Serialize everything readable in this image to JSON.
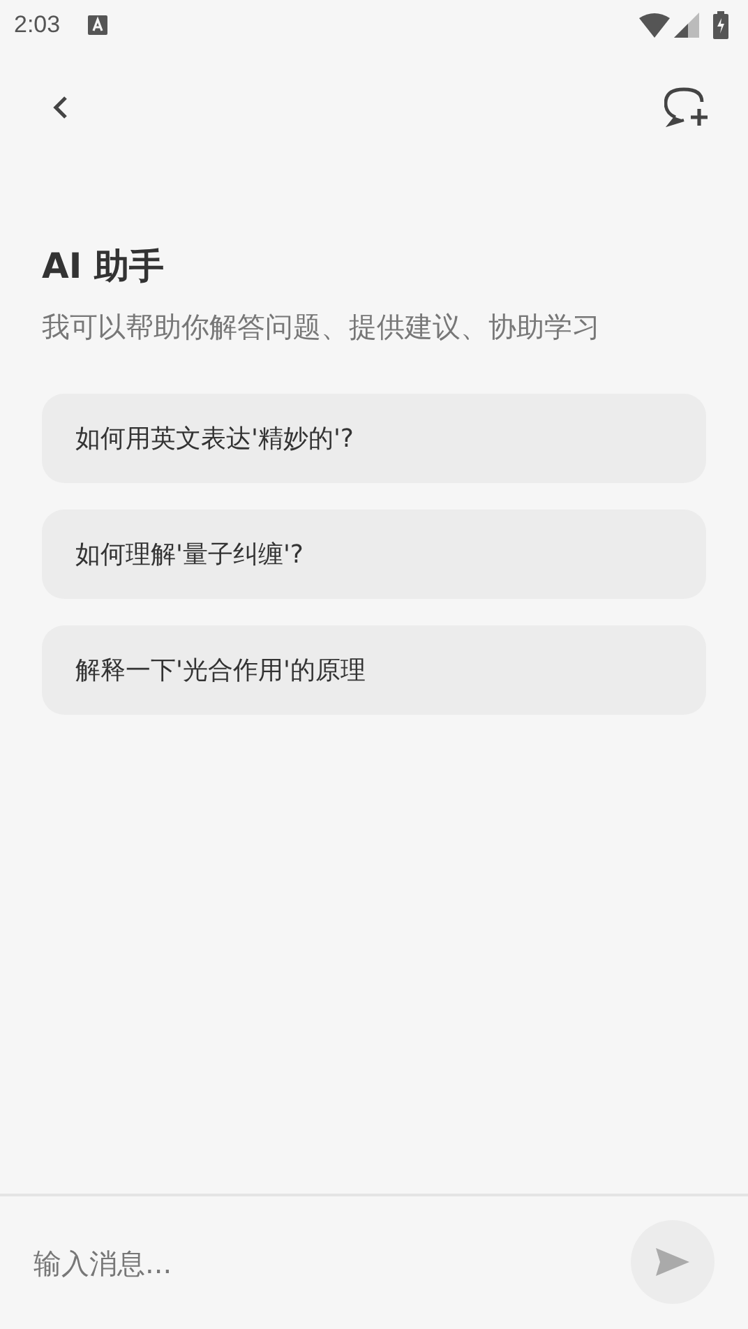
{
  "status_bar": {
    "time": "2:03"
  },
  "header": {
    "title": "AI 助手",
    "subtitle": "我可以帮助你解答问题、提供建议、协助学习"
  },
  "suggestions": [
    {
      "text": "如何用英文表达'精妙的'?"
    },
    {
      "text": "如何理解'量子纠缠'?"
    },
    {
      "text": "解释一下'光合作用'的原理"
    }
  ],
  "input": {
    "placeholder": "输入消息..."
  }
}
